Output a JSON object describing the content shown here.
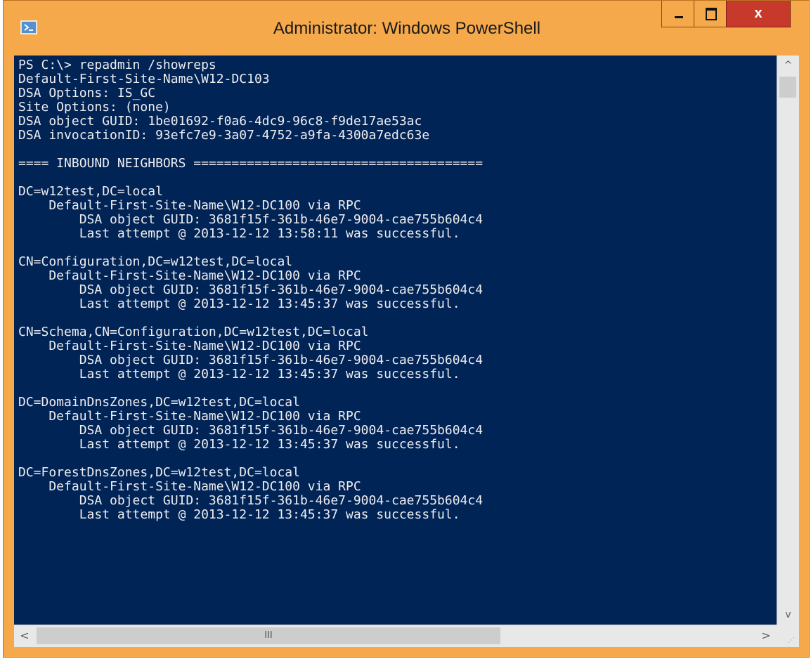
{
  "window": {
    "title": "Administrator: Windows PowerShell",
    "icon": "powershell-icon"
  },
  "caption_buttons": {
    "minimize": "minimize-icon",
    "maximize": "maximize-icon",
    "close": "x"
  },
  "console": {
    "lines": [
      "PS C:\\> repadmin /showreps",
      "Default-First-Site-Name\\W12-DC103",
      "DSA Options: IS_GC",
      "Site Options: (none)",
      "DSA object GUID: 1be01692-f0a6-4dc9-96c8-f9de17ae53ac",
      "DSA invocationID: 93efc7e9-3a07-4752-a9fa-4300a7edc63e",
      "",
      "==== INBOUND NEIGHBORS ======================================",
      "",
      "DC=w12test,DC=local",
      "    Default-First-Site-Name\\W12-DC100 via RPC",
      "        DSA object GUID: 3681f15f-361b-46e7-9004-cae755b604c4",
      "        Last attempt @ 2013-12-12 13:58:11 was successful.",
      "",
      "CN=Configuration,DC=w12test,DC=local",
      "    Default-First-Site-Name\\W12-DC100 via RPC",
      "        DSA object GUID: 3681f15f-361b-46e7-9004-cae755b604c4",
      "        Last attempt @ 2013-12-12 13:45:37 was successful.",
      "",
      "CN=Schema,CN=Configuration,DC=w12test,DC=local",
      "    Default-First-Site-Name\\W12-DC100 via RPC",
      "        DSA object GUID: 3681f15f-361b-46e7-9004-cae755b604c4",
      "        Last attempt @ 2013-12-12 13:45:37 was successful.",
      "",
      "DC=DomainDnsZones,DC=w12test,DC=local",
      "    Default-First-Site-Name\\W12-DC100 via RPC",
      "        DSA object GUID: 3681f15f-361b-46e7-9004-cae755b604c4",
      "        Last attempt @ 2013-12-12 13:45:37 was successful.",
      "",
      "DC=ForestDnsZones,DC=w12test,DC=local",
      "    Default-First-Site-Name\\W12-DC100 via RPC",
      "        DSA object GUID: 3681f15f-361b-46e7-9004-cae755b604c4",
      "        Last attempt @ 2013-12-12 13:45:37 was successful."
    ]
  },
  "scrollbars": {
    "up_glyph": "^",
    "down_glyph": "v",
    "left_glyph": "<",
    "right_glyph": ">",
    "h_thumb_grip": "III"
  },
  "colors": {
    "console_bg": "#012456",
    "console_fg": "#eeedf0",
    "frame": "#f6a94a",
    "close_button": "#c7392b"
  }
}
